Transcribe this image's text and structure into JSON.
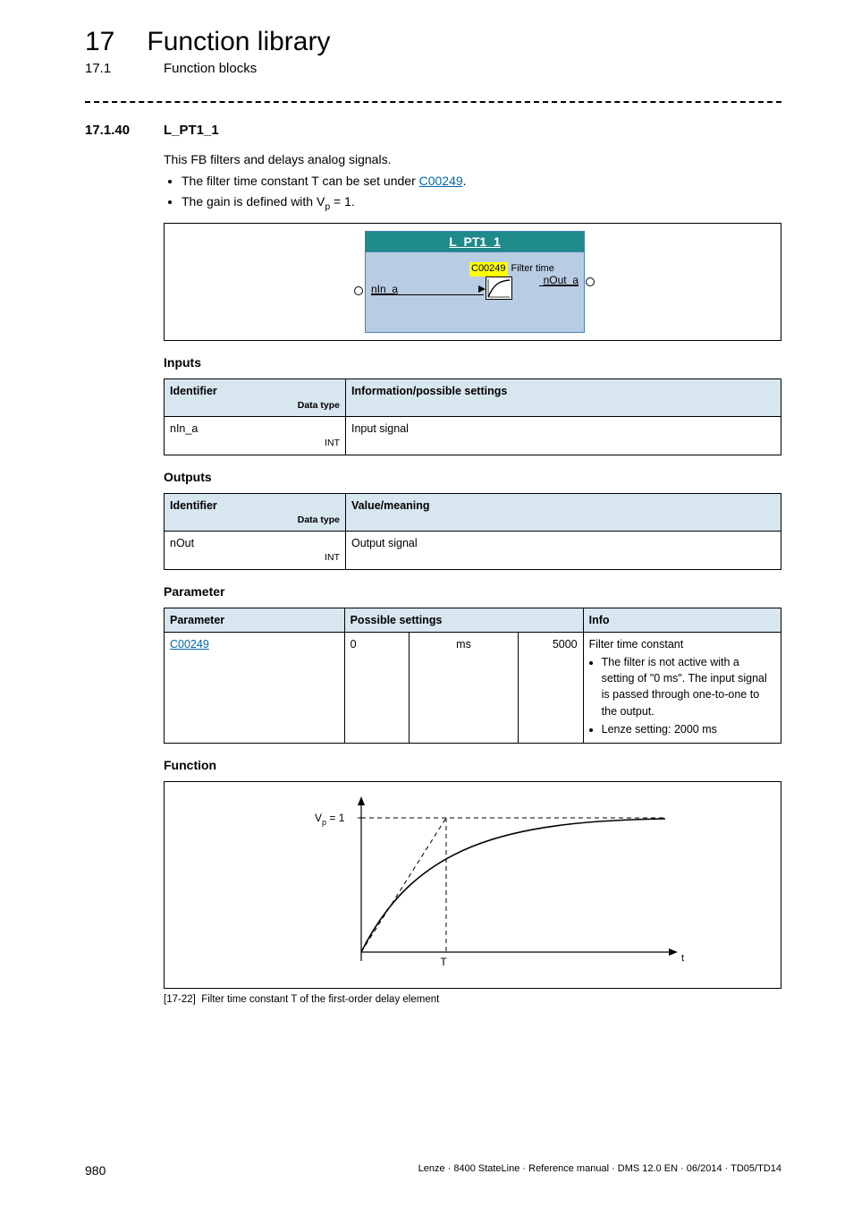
{
  "header": {
    "chapter_num": "17",
    "chapter_title": "Function library",
    "sub_num": "17.1",
    "sub_title": "Function blocks"
  },
  "section": {
    "num": "17.1.40",
    "title": "L_PT1_1"
  },
  "intro": {
    "text": "This FB filters and delays analog signals.",
    "bullet1_pre": "The filter time constant T can be set under ",
    "bullet1_link": "C00249",
    "bullet1_post": ".",
    "bullet2_pre": "The gain is defined with V",
    "bullet2_sub": "p",
    "bullet2_post": " = 1."
  },
  "block_diagram": {
    "title": "L_PT1_1",
    "input": "nIn_a",
    "output": "nOut_a",
    "param_code": "C00249",
    "param_label": "Filter time"
  },
  "inputs": {
    "heading": "Inputs",
    "col_identifier": "Identifier",
    "col_datatype": "Data type",
    "col_info": "Information/possible settings",
    "rows": [
      {
        "id": "nIn_a",
        "dt": "INT",
        "info": "Input signal"
      }
    ]
  },
  "outputs": {
    "heading": "Outputs",
    "col_identifier": "Identifier",
    "col_datatype": "Data type",
    "col_info": "Value/meaning",
    "rows": [
      {
        "id": "nOut",
        "dt": "INT",
        "info": "Output signal"
      }
    ]
  },
  "parameters": {
    "heading": "Parameter",
    "col_param": "Parameter",
    "col_ps": "Possible settings",
    "col_info": "Info",
    "row": {
      "code": "C00249",
      "min": "0",
      "unit": "ms",
      "max": "5000",
      "info_title": "Filter time constant",
      "info_b1": "The filter is not active with a setting of \"0 ms\". The input signal is passed through one-to-one to the output.",
      "info_b2": "Lenze setting: 2000 ms"
    }
  },
  "function": {
    "heading": "Function",
    "y_label_pre": "V",
    "y_label_sub": "p",
    "y_label_post": " = 1",
    "x_label": "t",
    "t_label": "T",
    "caption_tag": "[17-22]",
    "caption_text": "Filter time constant T of the first-order delay element"
  },
  "footer": {
    "page": "980",
    "text": "Lenze · 8400 StateLine · Reference manual · DMS 12.0 EN · 06/2014 · TD05/TD14"
  }
}
